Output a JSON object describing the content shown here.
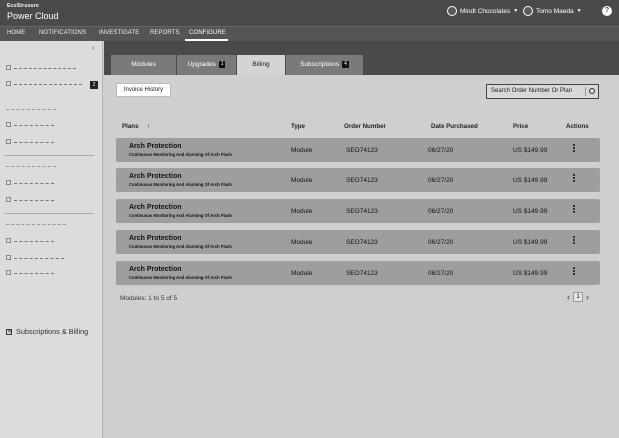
{
  "brand": {
    "company": "EcoStruxure",
    "product": "Power Cloud"
  },
  "account": {
    "company": "Mindt Chocolates",
    "user": "Tomo Maeda",
    "help": "?"
  },
  "nav": [
    "HOME",
    "NOTIFICATIONS",
    "INVESTIGATE",
    "REPORTS",
    "CONFIGURE"
  ],
  "sidebar": {
    "collapse": "‹",
    "badge": "2",
    "active": "Subscriptions & Billing"
  },
  "tabs": [
    {
      "label": "Modules",
      "count": ""
    },
    {
      "label": "Upgrades",
      "count": "1"
    },
    {
      "label": "Billing",
      "count": ""
    },
    {
      "label": "Subscriptions",
      "count": "4"
    }
  ],
  "toolbar": {
    "invoice_history": "Invoice History",
    "search_placeholder": "Search Order Number Or Plan"
  },
  "table": {
    "headers": {
      "plans": "Plans",
      "sort": "↑",
      "type": "Type",
      "order": "Order Number",
      "date": "Date Purchased",
      "price": "Price",
      "actions": "Actions"
    },
    "rows": [
      {
        "plan": "Arch Protection",
        "desc": "Continuous Monitoring And Alarming Of Arch Flash",
        "type": "Module",
        "order": "SEO74123",
        "date": "06/27/20",
        "price": "US $149.99"
      },
      {
        "plan": "Arch Protection",
        "desc": "Continuous Monitoring And Alarming Of Arch Flash",
        "type": "Module",
        "order": "SEO74123",
        "date": "06/27/20",
        "price": "US $149.99"
      },
      {
        "plan": "Arch Protection",
        "desc": "Continuous Monitoring And Alarming Of Arch Flash",
        "type": "Module",
        "order": "SEO74123",
        "date": "06/27/20",
        "price": "US $149.99"
      },
      {
        "plan": "Arch Protection",
        "desc": "Continuous Monitoring And Alarming Of Arch Flash",
        "type": "Module",
        "order": "SEO74123",
        "date": "06/27/20",
        "price": "US $149.99"
      },
      {
        "plan": "Arch Protection",
        "desc": "Continuous Monitoring And Alarming Of Arch Flash",
        "type": "Module",
        "order": "SEO74123",
        "date": "06/27/20",
        "price": "US $149.99"
      }
    ]
  },
  "footer": {
    "summary": "Modules: 1 to 5 of 5",
    "page": "1",
    "prev": "‹",
    "next": "›"
  }
}
